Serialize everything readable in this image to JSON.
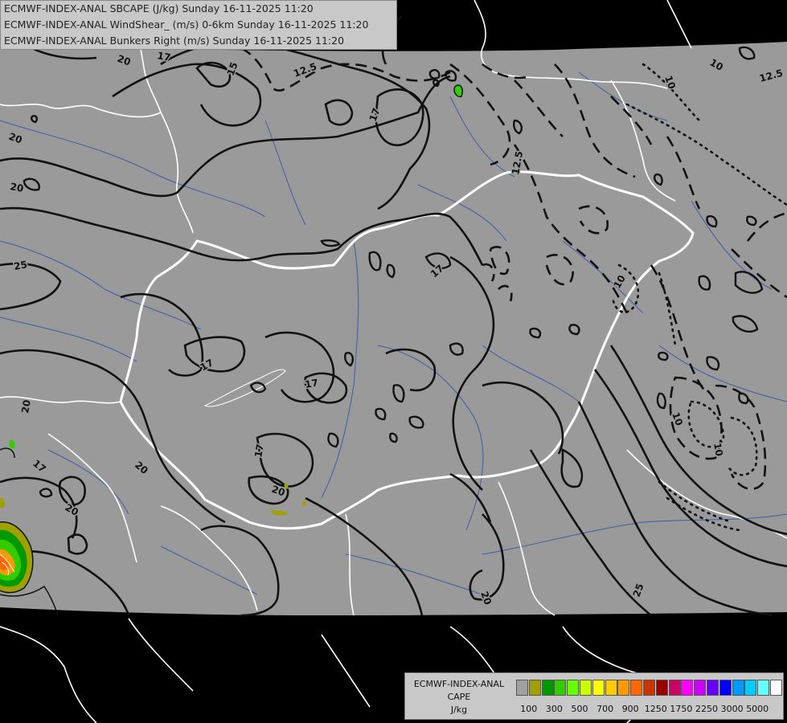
{
  "header": {
    "line1": "ECMWF-INDEX-ANAL SBCAPE (J/kg) Sunday 16-11-2025 11:20",
    "line2": "ECMWF-INDEX-ANAL WindShear_ (m/s) 0-6km Sunday 16-11-2025 11:20",
    "line3": "ECMWF-INDEX-ANAL Bunkers Right (m/s) Sunday 16-11-2025 11:20"
  },
  "legend": {
    "line1": "ECMWF-INDEX-ANAL",
    "line2": "CAPE",
    "line3": "J/kg",
    "colors": [
      "#a0a0a0",
      "#a0a000",
      "#009900",
      "#33cc00",
      "#66ff00",
      "#ccff00",
      "#ffff00",
      "#ffcc00",
      "#ff9900",
      "#ff6600",
      "#cc3300",
      "#990000",
      "#cc0066",
      "#ff00ff",
      "#cc00ff",
      "#6600ff",
      "#0000ff",
      "#0099ff",
      "#00ccff",
      "#66ffff",
      "#ffffff"
    ],
    "ticks": [
      "100",
      "300",
      "500",
      "700",
      "900",
      "1250",
      "1750",
      "2250",
      "3000",
      "5000"
    ]
  },
  "contour_labels": {
    "solid": [
      "20",
      "17",
      "15",
      "17",
      "20",
      "20",
      "25",
      "17",
      "17",
      "17",
      "17",
      "20",
      "20",
      "17",
      "20",
      "20",
      "20",
      "25"
    ],
    "dashed": [
      "12.5",
      "12.5",
      "12.5",
      "10",
      "10",
      "10",
      "10",
      "10"
    ]
  }
}
